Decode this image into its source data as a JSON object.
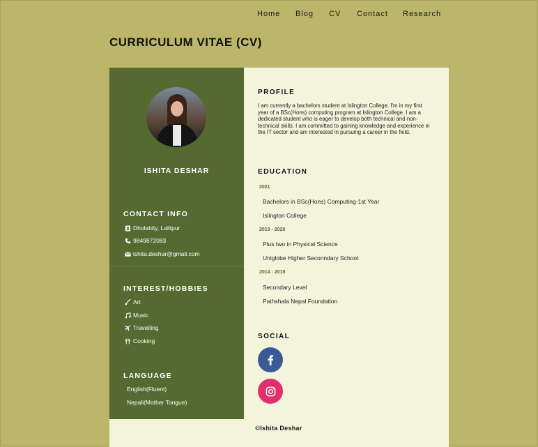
{
  "nav": {
    "items": [
      "Home",
      "Blog",
      "CV",
      "Contact",
      "Research"
    ]
  },
  "page_title": "CURRICULUM VITAE (CV)",
  "sidebar": {
    "name": "ISHITA DESHAR",
    "contact": {
      "heading": "CONTACT INFO",
      "items": [
        {
          "icon": "address-card-icon",
          "text": "Dholahity, Lalitpur"
        },
        {
          "icon": "phone-icon",
          "text": "9849872083"
        },
        {
          "icon": "envelope-icon",
          "text": "ishita.deshar@gmail.com"
        }
      ]
    },
    "interests": {
      "heading": "INTEREST/HOBBIES",
      "items": [
        {
          "icon": "paintbrush-icon",
          "text": "Art"
        },
        {
          "icon": "music-icon",
          "text": "Music"
        },
        {
          "icon": "plane-icon",
          "text": "Travelling"
        },
        {
          "icon": "utensils-icon",
          "text": "Cooking"
        }
      ]
    },
    "language": {
      "heading": "LANGUAGE",
      "items": [
        "English(Fluent)",
        "Nepali(Mother Tongue)"
      ]
    }
  },
  "main": {
    "profile": {
      "heading": "PROFILE",
      "text": "I am currently a bachelors student at Islington College. I'm in my first year of a BSc(Hons) computing program at Islington College. I am a dedicated student who is eager to develop both technical and non-technical skills. I am committed to gaining knowledge and experience in the IT sector and am interested in pursuing a career in the field."
    },
    "education": {
      "heading": "EDUCATION",
      "entries": [
        {
          "year": "2021",
          "lines": [
            "Bachelors in BSc(Hons) Computing-1st Year",
            "Islington College"
          ]
        },
        {
          "year": "2019 - 2020",
          "lines": [
            "Plus two in Physical Science",
            "Uniglobe Higher Seconndary School"
          ]
        },
        {
          "year": "2014 - 2018",
          "lines": [
            "Secondary Level",
            "Pathshala Nepal Foundation"
          ]
        }
      ]
    },
    "social": {
      "heading": "SOCIAL",
      "facebook": {
        "icon": "facebook-icon",
        "color": "#3b5998"
      },
      "instagram": {
        "icon": "instagram-icon",
        "color": "#e1306c"
      }
    },
    "copyright": "©Ishita Deshar"
  },
  "colors": {
    "page_bg": "#bcb66a",
    "sidebar_bg": "#546a30",
    "main_bg": "#f4f3dc",
    "year_accent": "#546a30"
  }
}
